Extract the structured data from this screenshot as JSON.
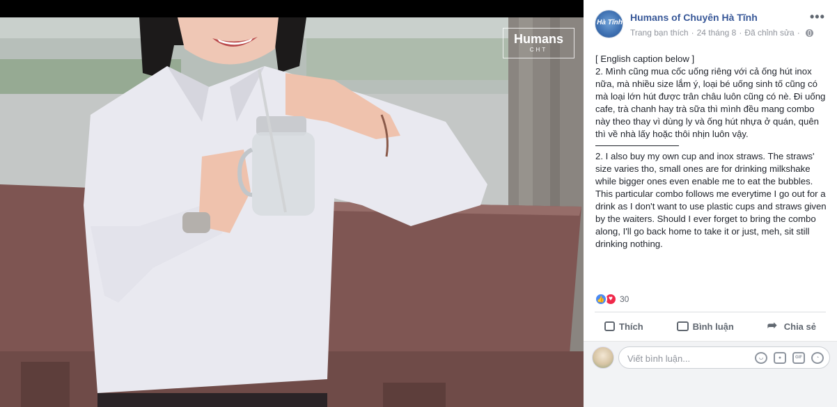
{
  "photo": {
    "watermark_main": "Humans",
    "watermark_sub": "CHT"
  },
  "post": {
    "page_name": "Humans of Chuyên Hà Tĩnh",
    "avatar_text": "Hà Tĩnh",
    "meta_liked": "Trang bạn thích",
    "meta_date": "24 tháng 8",
    "meta_edited": "Đã chỉnh sửa",
    "caption": {
      "line1": "[ English caption below ]",
      "vi": "2. Mình cũng mua cốc uống riêng với cả ống hút inox nữa, mà nhiều size lắm ý, loại bé uống sinh tố cũng có mà loại lớn hút được trân châu luôn cũng có nè. Đi uống cafe, trà chanh hay trà sữa thì mình đều mang combo này theo thay vì dùng ly và ống hút nhựa ở quán, quên thì về nhà lấy hoặc thôi nhịn luôn vậy.",
      "en": "2. I also buy my own cup and inox straws. The straws' size varies tho, small ones are for drinking milkshake while bigger ones even enable me to eat the bubbles. This particular combo follows me everytime I go out for a drink as I don't want to use plastic cups and straws given by the waiters. Should I ever forget to bring the combo along, I'll go back home to take it or just, meh, sit still drinking nothing."
    },
    "reaction_count": "30",
    "actions": {
      "like": "Thích",
      "comment": "Bình luận",
      "share": "Chia sẻ"
    },
    "comment_placeholder": "Viết bình luận...",
    "comment_icons": {
      "gif": "GIF"
    }
  },
  "colors": {
    "brand": "#385898",
    "meta": "#90949c",
    "like": "#4a8af4",
    "love": "#f0284a"
  }
}
